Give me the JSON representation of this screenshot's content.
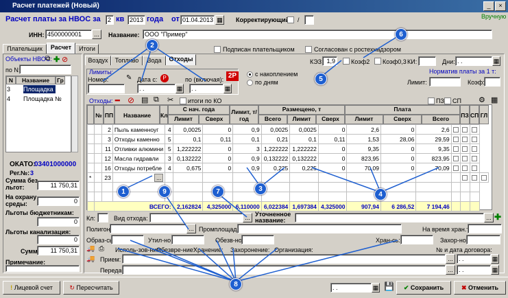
{
  "window": {
    "title": "Расчет платежей (Новый)"
  },
  "header": {
    "calc_label": "Расчет платы за НВОС за",
    "quarter_value": "2",
    "quarter_unit": "кв",
    "year_value": "2013",
    "year_unit": "года",
    "from_label": "от",
    "date_value": "01.04.2013",
    "correcting_label": "Корректирующий",
    "correcting_sep": "/",
    "manual_label": "Вручную",
    "inn_label": "ИНН:",
    "inn_value": "4500000001",
    "name_label": "Название:",
    "name_value": "ООО \"Пример\""
  },
  "top_tabs": [
    "Плательщик",
    "Расчет",
    "Итоги"
  ],
  "signed_label": "Подписан плательщиком",
  "agreed_label": "Согласован с ростехнадзором",
  "left": {
    "objects_label": "Объекты НВОС:",
    "po_n_label": "по N:",
    "cols": [
      "N",
      "Название",
      "Гр"
    ],
    "rows": [
      {
        "n": "3",
        "name": "Площадка №",
        "sel": true
      },
      {
        "n": "4",
        "name": "Площадка №",
        "sel": false
      }
    ],
    "okato_label": "ОКАТО:",
    "okato_value": "03401000000",
    "reg_label": "Рег.№:",
    "reg_value": "3",
    "sum_no_benefit_label": "Сумма без льгот:",
    "sum_no_benefit_value": "11 750,31",
    "protection_label": "На охрану среды:",
    "protection_value": "0",
    "budget_label": "Льготы бюджетникам:",
    "budget_value": "0",
    "sewer_label": "Льготы канализация:",
    "sewer_value": "0",
    "sum_label": "Сумма:",
    "sum_value": "11 750,31",
    "note_label": "Примечание:"
  },
  "sub_tabs": [
    "Воздух",
    "Топливо",
    "Вода",
    "Отходы"
  ],
  "kez_label": "КЭЗ:",
  "kez_value": "1,9",
  "koef2_label": "Коэф2",
  "koef03_label": "Коэф0,3",
  "ki_label": "КИ:",
  "days_label": "Дни:",
  "days_value": ". .",
  "limits": {
    "title": "Лимиты:",
    "number_label": "Номер:",
    "date_from_label": "Дата с:",
    "date_from_value": ". .",
    "date_to_label": "по (включая):",
    "date_to_value": ". .",
    "radio_accum": "с накоплением",
    "radio_days": "по дням"
  },
  "norm_title": "Норматив платы за 1 т:",
  "limit_label": "Лимит:",
  "koef_label": "Коэф:",
  "waste": {
    "title": "Отходы:",
    "totals_ko_label": "итоги по КО",
    "pz_label": "ПЗ",
    "sp_label": "СП",
    "col_headers": [
      "№",
      "ПП",
      "Название",
      "Кл",
      "С нач. года",
      "Лимит, т/год",
      "Размещено, т",
      "Плата",
      "ПЗ",
      "СП",
      "ГЛ"
    ],
    "sub_headers": [
      "Лимит",
      "Сверх",
      "Всего",
      "Лимит",
      "Сверх",
      "Лимит",
      "Сверх",
      "Всего"
    ],
    "rows": [
      {
        "pp": "2",
        "name": "Пыль каменноуг",
        "kl": "4",
        "c_lim": "0,0025",
        "c_over": "0",
        "limit": "0,9",
        "total": "0,0025",
        "p_lim": "0,0025",
        "p_over": "0",
        "pay_lim": "2,6",
        "pay_over": "0",
        "pay_total": "2,6"
      },
      {
        "pp": "3",
        "name": "Отходы каменно",
        "kl": "5",
        "c_lim": "0,1",
        "c_over": "0,11",
        "limit": "0,1",
        "total": "0,21",
        "p_lim": "0,1",
        "p_over": "0,11",
        "pay_lim": "1,53",
        "pay_over": "28,06",
        "pay_total": "29,59"
      },
      {
        "pp": "11",
        "name": "Отливки алюмини",
        "kl": "5",
        "c_lim": "1,222222",
        "c_over": "0",
        "limit": "3",
        "total": "1,222222",
        "p_lim": "1,222222",
        "p_over": "0",
        "pay_lim": "9,35",
        "pay_over": "0",
        "pay_total": "9,35"
      },
      {
        "pp": "12",
        "name": "Масла гидравли",
        "kl": "3",
        "c_lim": "0,132222",
        "c_over": "0",
        "limit": "0,9",
        "total": "0,132222",
        "p_lim": "0,132222",
        "p_over": "0",
        "pay_lim": "823,95",
        "pay_over": "0",
        "pay_total": "823,95"
      },
      {
        "pp": "16",
        "name": "Отходы потребле",
        "kl": "4",
        "c_lim": "0,675",
        "c_over": "0",
        "limit": "0,9",
        "total": "0,225",
        "p_lim": "0,225",
        "p_over": "0",
        "pay_lim": "70,09",
        "pay_over": "0",
        "pay_total": "70,09"
      }
    ],
    "new_row_pp": "23",
    "totals": {
      "label": "ВСЕГО:",
      "c_lim": "2,162824",
      "c_over": "4,325000",
      "limit": "6,110000",
      "total": "6,022384",
      "p_lim": "1,697384",
      "p_over": "4,325000",
      "pay_lim": "907,94",
      "pay_over": "6 286,52",
      "pay_total": "7 194,46"
    }
  },
  "details": {
    "kl_label": "Кл:",
    "kind_label": "Вид отхода:",
    "refined_label": "Уточненное название:",
    "polygon_label": "Полигон:",
    "subsite_label": "Промплощадка:",
    "temp_store_label": "На время хран.т:",
    "formed_label": "Образ-сь:",
    "util_label": "Утил-но:",
    "neutral_label": "Обезв-но:",
    "stored_label": "Хран-сь:",
    "buried_label": "Захор-но:",
    "use_label": "Исполь-зов-ние:",
    "neutralize_label": "Обезвре-ние:",
    "storage_label": "Хранение:",
    "burial_label": "Захоронение:",
    "org_label": "Организация:",
    "contract_label": "№ и дата договора:",
    "reception_label": "Прием:",
    "transfer_label": "Передача:",
    "contract_date_value": ". ."
  },
  "callouts": [
    "1",
    "2",
    "3",
    "4",
    "5",
    "6",
    "7",
    "8",
    "9"
  ],
  "footer": {
    "account_button": "Лицевой счет",
    "recalc_button": "Пересчитать",
    "date_value": ". .",
    "save_button": "Сохранить",
    "cancel_button": "Отменить"
  }
}
